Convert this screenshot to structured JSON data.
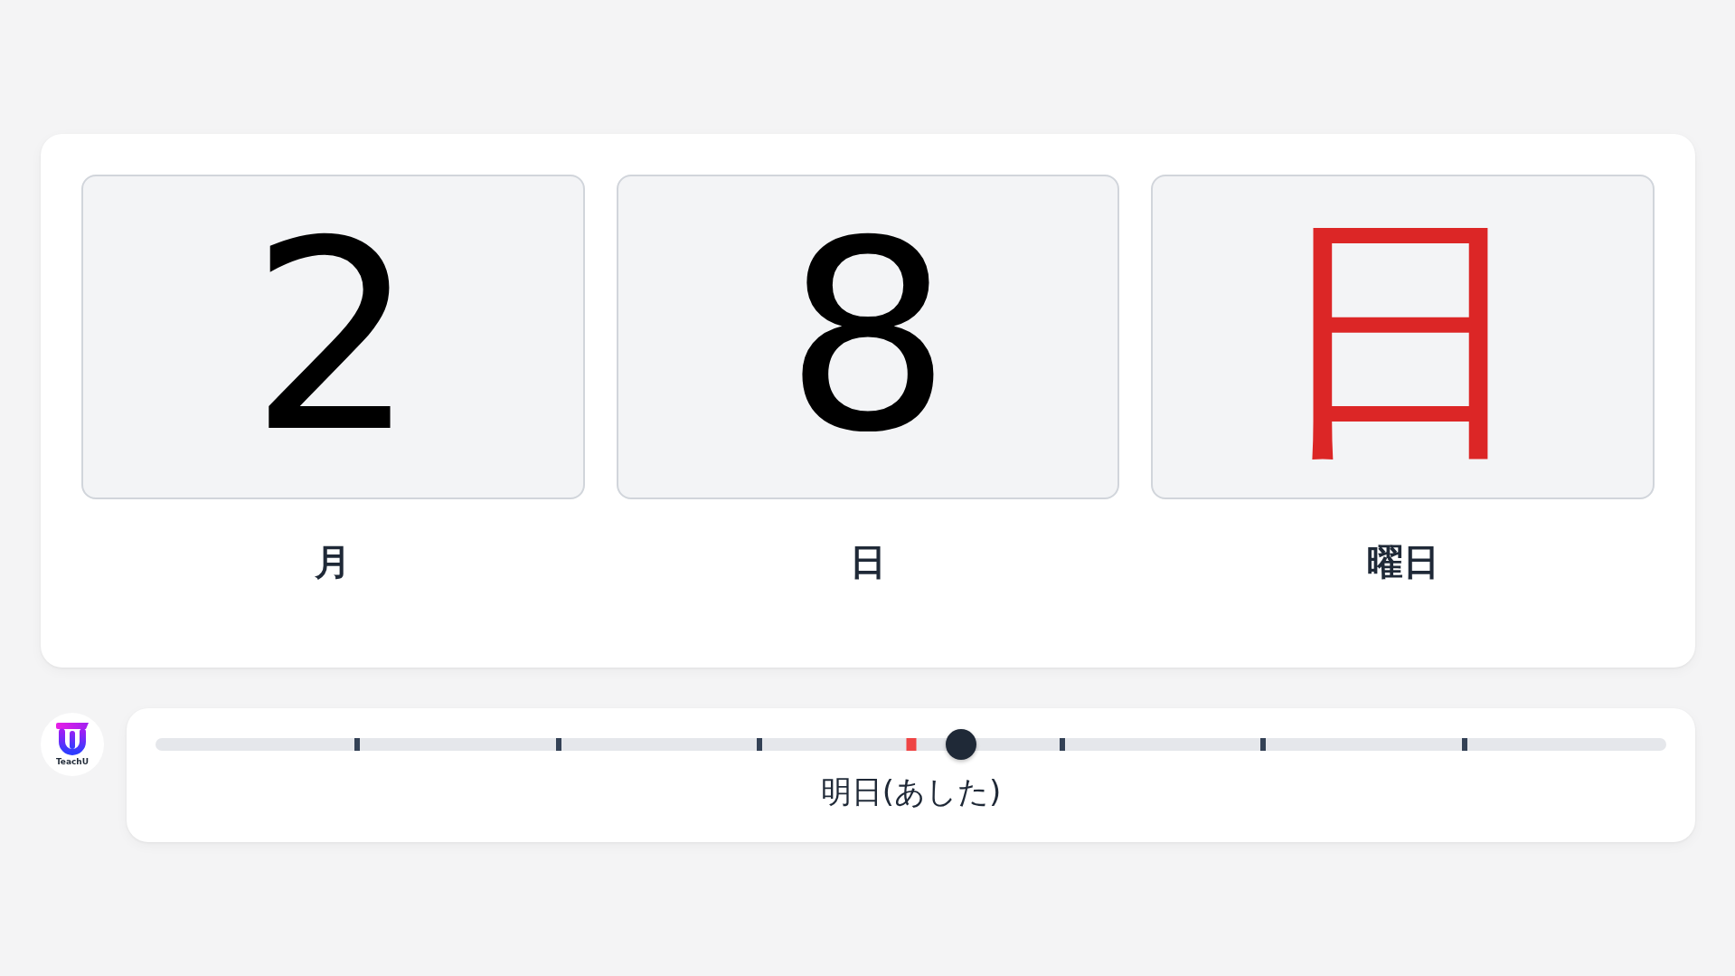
{
  "date_tiles": [
    {
      "value": "2",
      "label": "月",
      "color": "#000000"
    },
    {
      "value": "8",
      "label": "日",
      "color": "#000000"
    },
    {
      "value": "日",
      "label": "曜日",
      "color": "#dc2626"
    }
  ],
  "logo": {
    "text": "TeachU"
  },
  "slider": {
    "level": 0.533,
    "ticks": [
      {
        "kind": "minor",
        "color": "#334155"
      },
      {
        "kind": "minor",
        "color": "#334155"
      },
      {
        "kind": "minor",
        "color": "#334155"
      },
      {
        "kind": "major",
        "color": "#ef4444"
      },
      {
        "kind": "minor",
        "color": "#334155"
      },
      {
        "kind": "minor",
        "color": "#334155"
      },
      {
        "kind": "minor",
        "color": "#334155"
      }
    ],
    "label": "明日(あした)"
  }
}
